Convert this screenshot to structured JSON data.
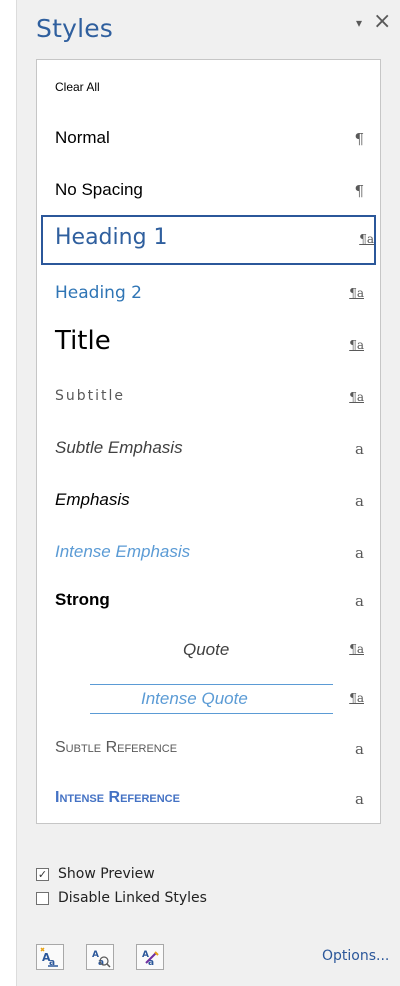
{
  "pane": {
    "title": "Styles",
    "menu_icon": "▾",
    "close_icon": "×"
  },
  "styles": [
    {
      "name": "Clear All",
      "type": ""
    },
    {
      "name": "Normal",
      "type": "¶"
    },
    {
      "name": "No Spacing",
      "type": "¶"
    },
    {
      "name": "Heading 1",
      "type": "¶a",
      "selected": true
    },
    {
      "name": "Heading 2",
      "type": "¶a"
    },
    {
      "name": "Title",
      "type": "¶a"
    },
    {
      "name": "Subtitle",
      "type": "¶a"
    },
    {
      "name": "Subtle Emphasis",
      "type": "a"
    },
    {
      "name": "Emphasis",
      "type": "a"
    },
    {
      "name": "Intense Emphasis",
      "type": "a"
    },
    {
      "name": "Strong",
      "type": "a"
    },
    {
      "name": "Quote",
      "type": "¶a"
    },
    {
      "name": "Intense Quote",
      "type": "¶a"
    },
    {
      "name": "Subtle Reference",
      "type": "a"
    },
    {
      "name": "Intense Reference",
      "type": "a"
    }
  ],
  "footer": {
    "show_preview": {
      "label": "Show Preview",
      "checked": true,
      "mark": "✓"
    },
    "disable_linked": {
      "label": "Disable Linked Styles",
      "checked": false,
      "mark": ""
    },
    "options_label": "Options..."
  },
  "colors": {
    "accent": "#2b579a",
    "heading": "#2f5f9e",
    "light_blue": "#5b9bd5"
  }
}
